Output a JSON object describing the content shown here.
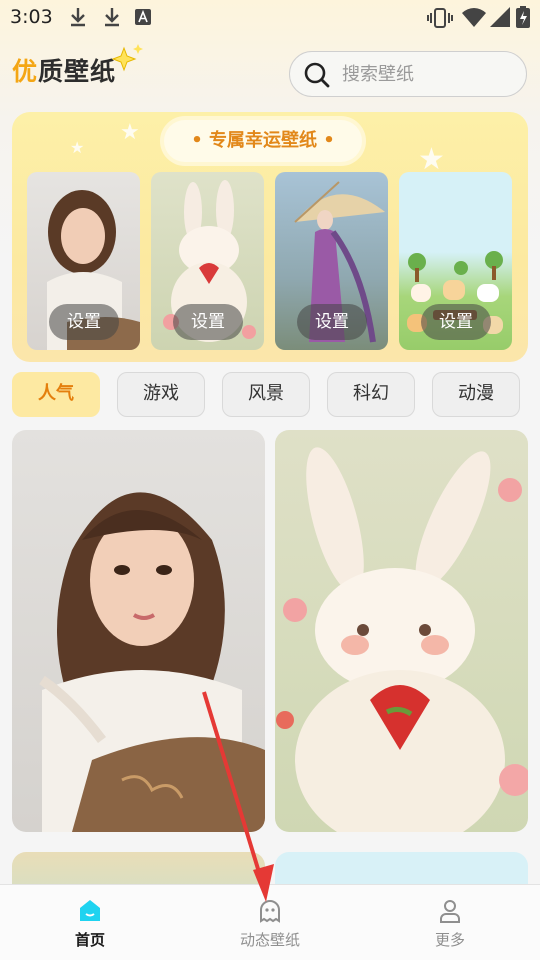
{
  "status_bar": {
    "time": "3:03"
  },
  "header": {
    "logo_part1": "优",
    "logo_part2": "质壁纸",
    "search_placeholder": "搜索壁纸"
  },
  "lucky": {
    "title": "• 专属幸运壁纸 •",
    "items": [
      {
        "button": "设置"
      },
      {
        "button": "设置"
      },
      {
        "button": "设置"
      },
      {
        "button": "设置"
      }
    ]
  },
  "categories": [
    "人气",
    "游戏",
    "风景",
    "科幻",
    "动漫"
  ],
  "active_category": "人气",
  "bottom_nav": {
    "items": [
      {
        "label": "首页",
        "icon": "home-icon",
        "active": true
      },
      {
        "label": "动态壁纸",
        "icon": "ghost-icon",
        "active": false
      },
      {
        "label": "更多",
        "icon": "person-icon",
        "active": false
      }
    ]
  },
  "colors": {
    "accent": "#f4a614",
    "nav_active": "#1fd3f0",
    "arrow": "#e53935"
  }
}
